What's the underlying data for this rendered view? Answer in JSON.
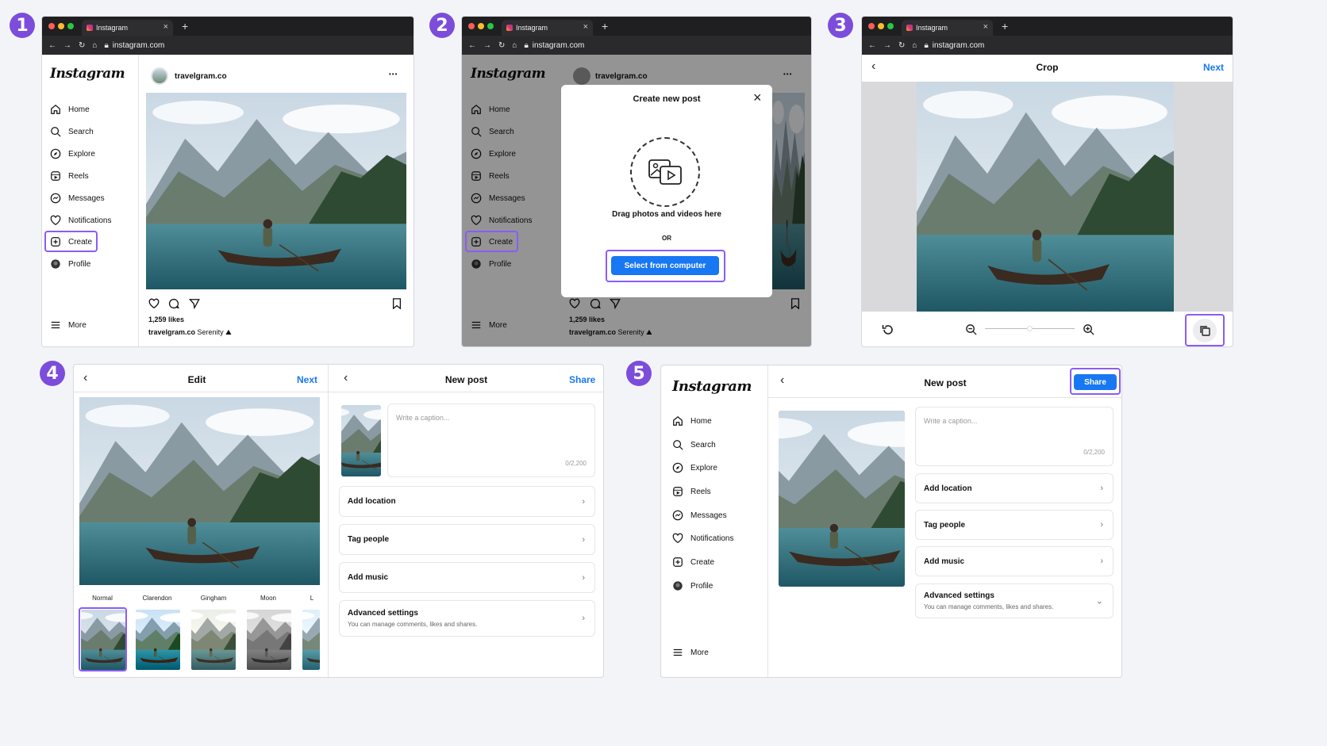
{
  "steps": [
    "1",
    "2",
    "3",
    "4",
    "5"
  ],
  "browser": {
    "tab_title": "Instagram",
    "tab_close": "×",
    "new_tab": "+",
    "url": "instagram.com"
  },
  "app": {
    "logo": "Instagram"
  },
  "nav": {
    "home": "Home",
    "search": "Search",
    "explore": "Explore",
    "reels": "Reels",
    "messages": "Messages",
    "notifications": "Notifications",
    "create": "Create",
    "profile": "Profile",
    "more": "More"
  },
  "post": {
    "username": "travelgram.co",
    "likes": "1,259 likes",
    "caption_user": "travelgram.co",
    "caption_text": "Serenity ⛰",
    "more_dots": "•••"
  },
  "create_modal": {
    "title": "Create new post",
    "drag_text": "Drag photos and videos here",
    "or": "OR",
    "select_button": "Select from computer",
    "close": "×"
  },
  "crop": {
    "title": "Crop",
    "next": "Next"
  },
  "edit": {
    "title": "Edit",
    "next": "Next",
    "filters": [
      "Normal",
      "Clarendon",
      "Gingham",
      "Moon",
      "L"
    ]
  },
  "newpost": {
    "title": "New post",
    "share": "Share",
    "caption_placeholder": "Write a caption...",
    "caption_count": "0/2,200",
    "add_location": "Add location",
    "tag_people": "Tag people",
    "add_music": "Add music",
    "advanced": "Advanced settings",
    "advanced_sub": "You can manage comments, likes and shares."
  },
  "colors": {
    "accent": "#1877f2",
    "highlight": "#8b5cf6",
    "step_badge": "#7c4ddb"
  }
}
